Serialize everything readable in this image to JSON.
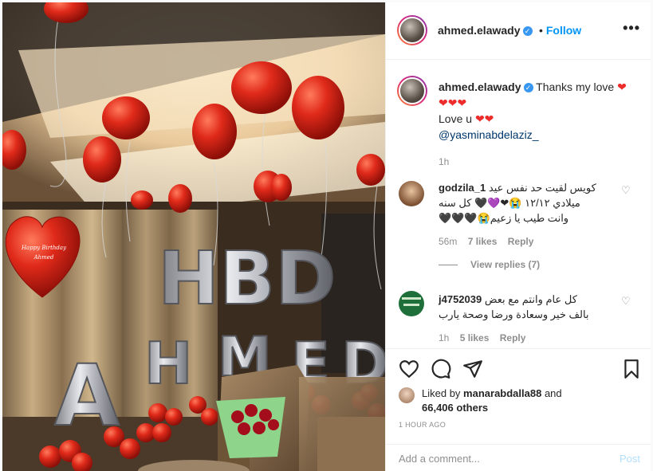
{
  "post": {
    "username": "ahmed.elawady",
    "follow_label": "Follow",
    "more_label": "•••"
  },
  "caption": {
    "username": "ahmed.elawady",
    "text_line1": "Thanks my love",
    "hearts_line1": "❤",
    "hearts_line2": "❤❤❤",
    "text_line3": "Love u",
    "hearts_line3": "❤❤",
    "mention": "@yasminabdelaziz_",
    "time": "1h"
  },
  "comments": [
    {
      "username": "godzila_1",
      "text_line1": "كويس لقيت حد نفس عيد",
      "text_line2": "ميلادي ١٢/١٢ 😭❤💜🖤 كل سنه",
      "text_line3": "وانت طيب يا زعيم😭🖤🖤🖤",
      "time": "56m",
      "likes": "7 likes",
      "reply": "Reply",
      "view_replies": "View replies (7)"
    },
    {
      "username": "j4752039",
      "text_line1": "كل عام وانتم مع بعض",
      "text_line2": "بالف خير وسعادة ورضا وصحة يارب",
      "time": "1h",
      "likes": "5 likes",
      "reply": "Reply"
    }
  ],
  "likes": {
    "prefix": "Liked by",
    "user": "manarabdalla88",
    "and": "and",
    "others": "66,406 others"
  },
  "timestamp": "1 HOUR AGO",
  "add_comment": {
    "placeholder": "Add a comment...",
    "post_label": "Post"
  },
  "photo": {
    "balloon_text": "Happy Birthday Ahmed",
    "letters_top": "HBD",
    "letters_bottom": "AHMED"
  },
  "colors": {
    "accent": "#0095f6",
    "like_red": "#ed2b2b",
    "balloon_red": "#e02a1a"
  }
}
